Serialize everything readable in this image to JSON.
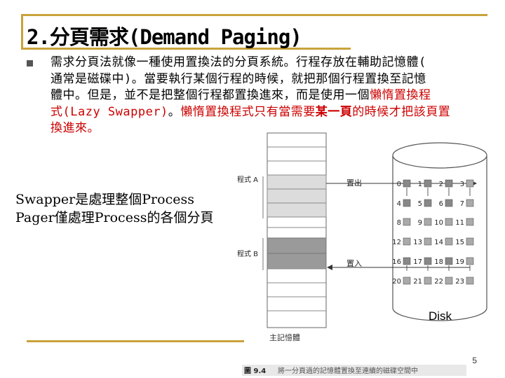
{
  "slide": {
    "title": "2.分頁需求(Demand Paging)",
    "page_number": "5"
  },
  "body": {
    "line1": "需求分頁法就像一種使用置換法的分頁系統。行程存放在輔助記憶體(",
    "line2": "通常是磁碟中)。當要執行某個行程的時候，就把那個行程置換至記憶",
    "line3_a": "體中。但是，並不是把整個行程都置換進來，而是使用一個",
    "line3_red": "懶惰置換程",
    "line4_red": "式(Lazy Swapper)",
    "line4_a": "。",
    "line4_b": "懶惰置換程式只有當需要",
    "line4_bold": "某一頁",
    "line4_c": "的時候才把該頁置",
    "line5": "換進來。"
  },
  "note": {
    "line1": "Swapper是處理整個Process",
    "line2": "Pager僅處理Process的各個分頁"
  },
  "figure": {
    "program_a": "程式 A",
    "program_b": "程式 B",
    "swap_out": "置出",
    "swap_in": "置入",
    "disk": "Disk",
    "main_memory": "主記憶體",
    "caption_num": "圖 9.4",
    "caption": "將一分頁過的記憶體置換至連續的磁碟空間中",
    "disk_rows": [
      [
        "0",
        "1",
        "2",
        "3"
      ],
      [
        "4",
        "5",
        "6",
        "7"
      ],
      [
        "8",
        "9",
        "10",
        "11"
      ],
      [
        "12",
        "13",
        "14",
        "15"
      ],
      [
        "16",
        "17",
        "18",
        "19"
      ],
      [
        "20",
        "21",
        "22",
        "23"
      ]
    ]
  }
}
